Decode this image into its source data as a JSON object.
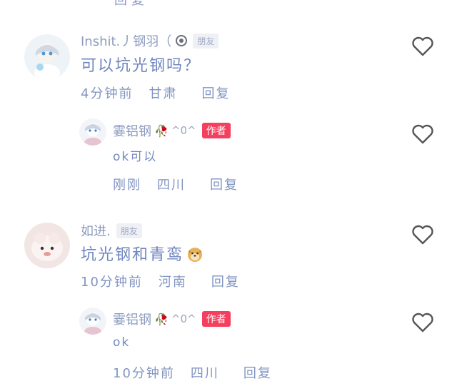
{
  "top_clip": "回复",
  "comments": [
    {
      "username": "Inshit.丿钢羽（",
      "friend_badge": "朋友",
      "content": "可以坑光钢吗？",
      "time": "4分钟前",
      "location": "甘肃",
      "reply": "回复",
      "reply_comment": {
        "username": "霎铝钢",
        "rose": "🥀",
        "face": "^0^",
        "author_badge": "作者",
        "content": "ok可以",
        "time": "刚刚",
        "location": "四川",
        "reply": "回复"
      }
    },
    {
      "username": "如进.",
      "friend_badge": "朋友",
      "content": "坑光钢和青鸾",
      "emoji": "doge",
      "time": "10分钟前",
      "location": "河南",
      "reply": "回复",
      "reply_comment": {
        "username": "霎铝钢",
        "rose": "🥀",
        "face": "^0^",
        "author_badge": "作者",
        "content": "ok",
        "time": "10分钟前",
        "location": "四川",
        "reply": "回复"
      }
    }
  ]
}
